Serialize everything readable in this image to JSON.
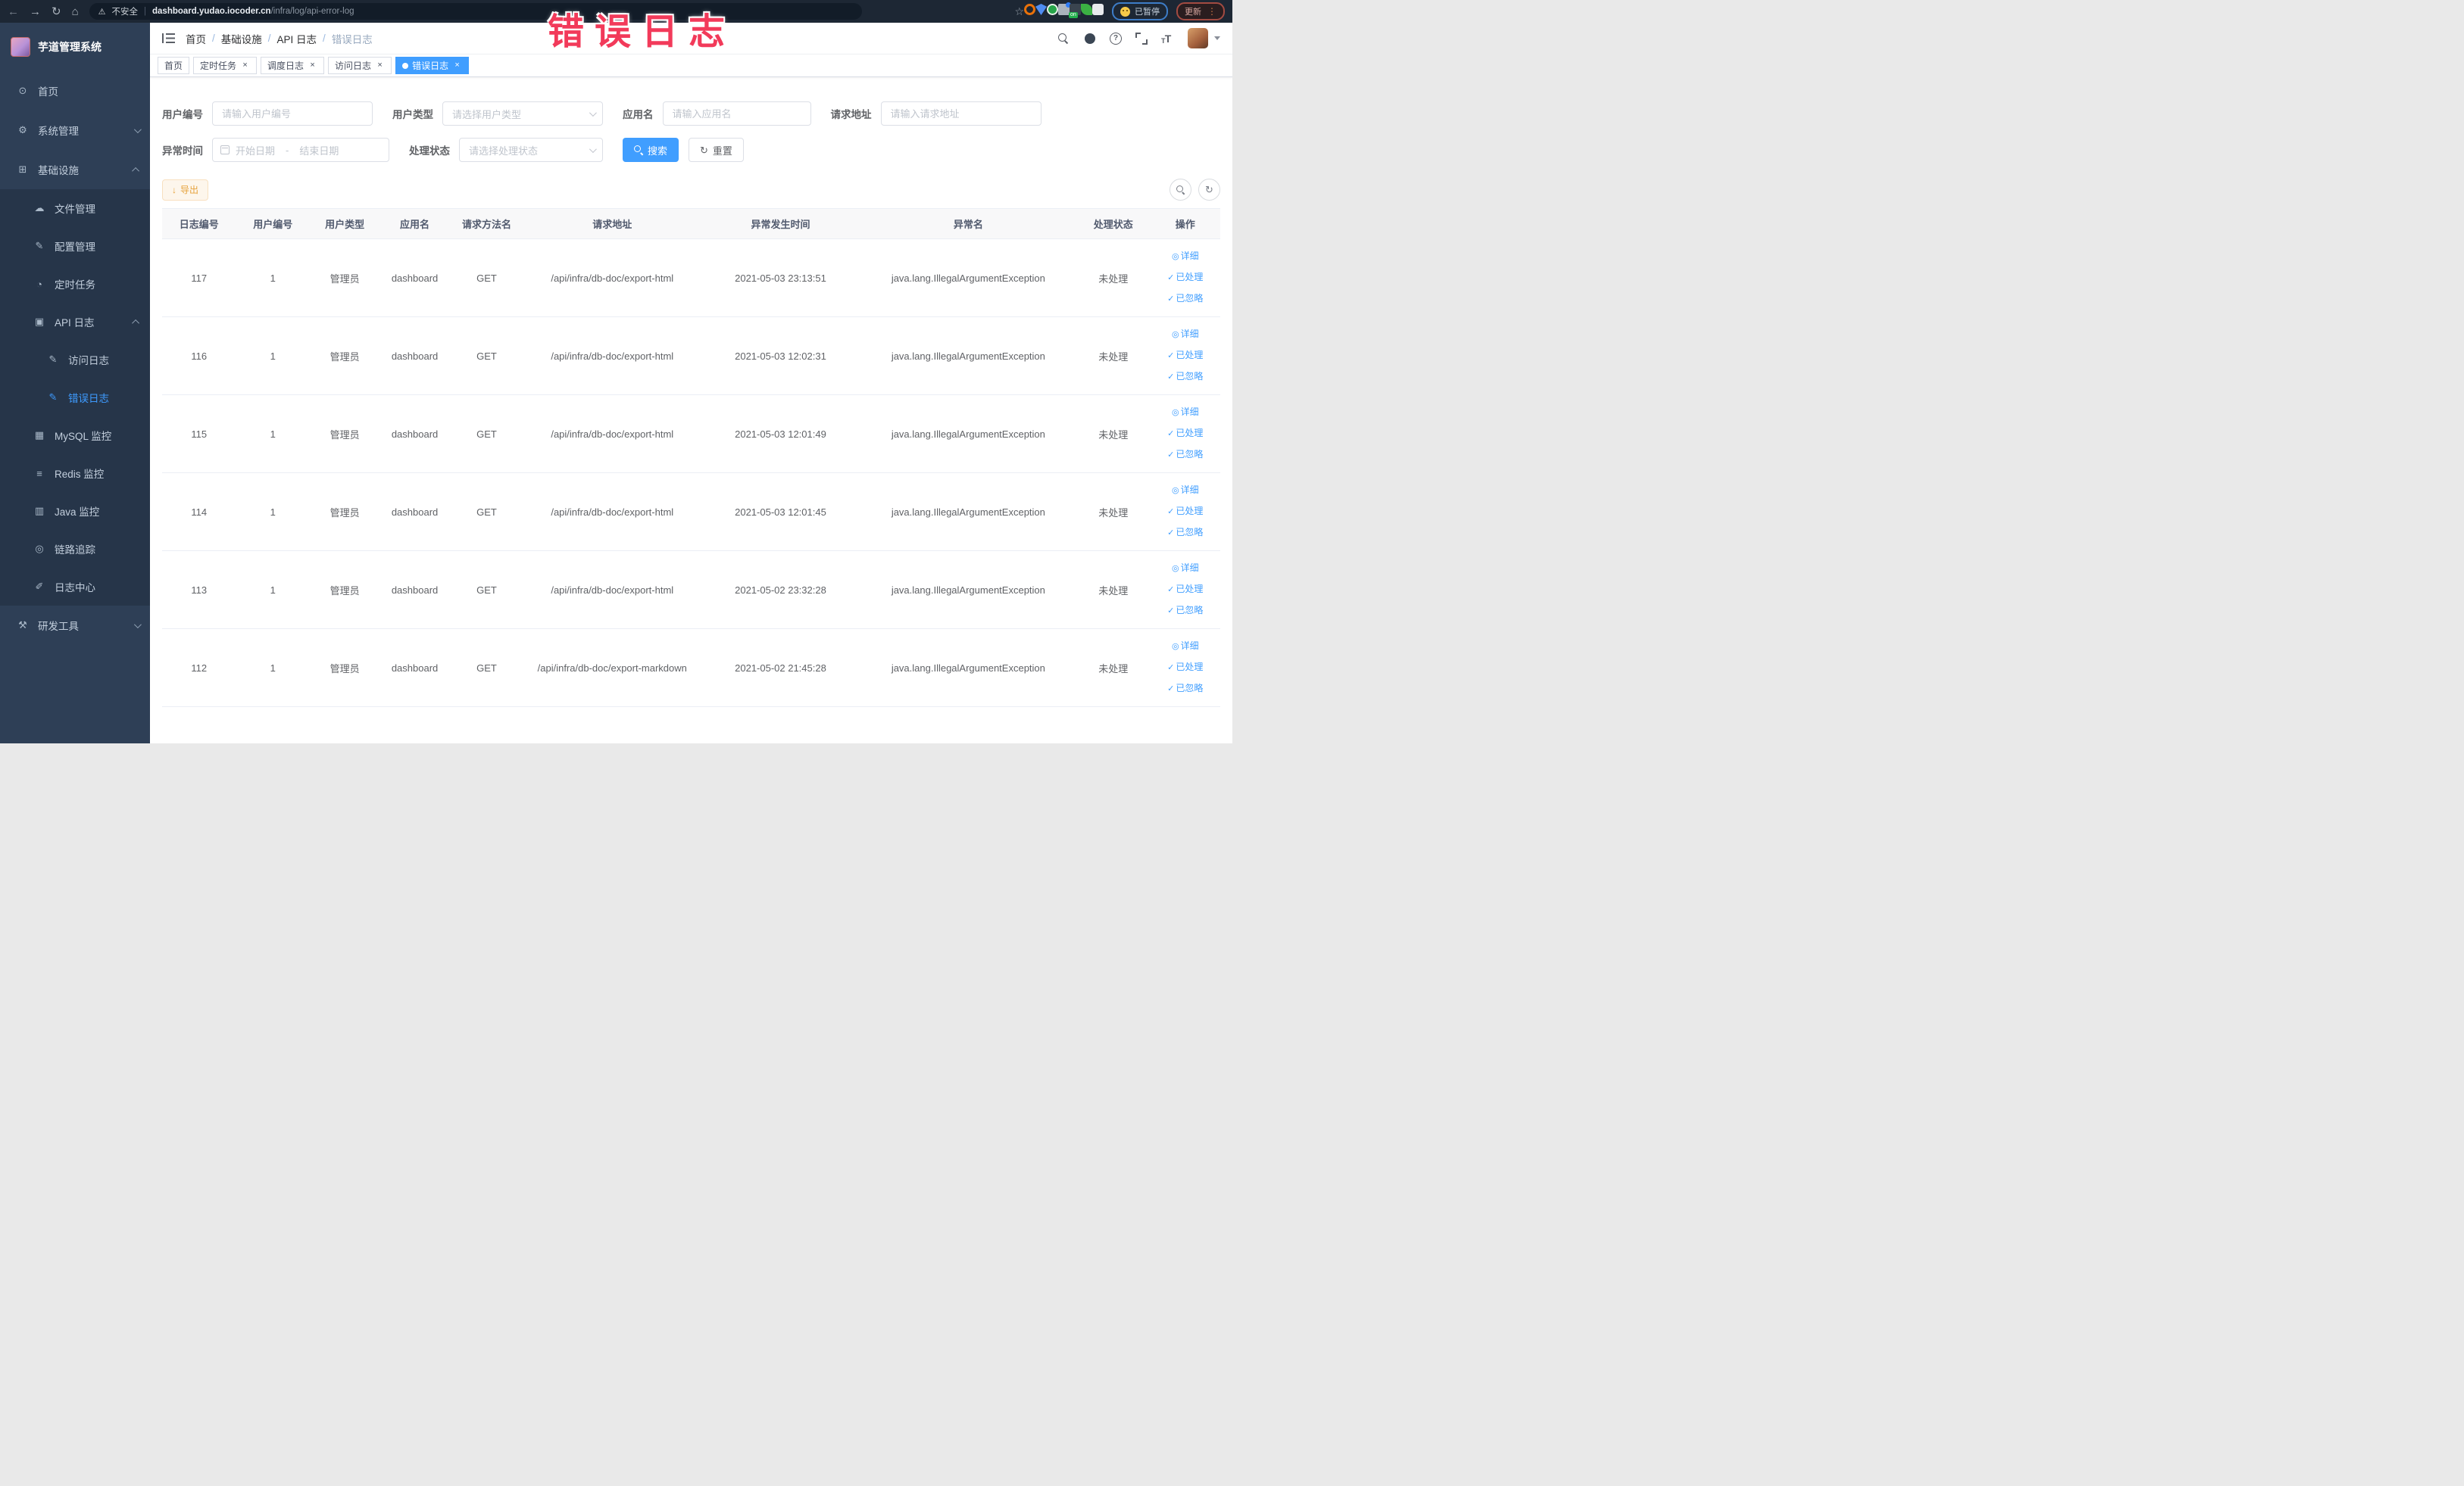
{
  "browser": {
    "security_label": "不安全",
    "url_host": "dashboard.yudao.iocoder.cn",
    "url_path": "/infra/log/api-error-log",
    "paused_label": "已暂停",
    "update_label": "更新",
    "kebab": "⋮",
    "nav": {
      "back": "←",
      "forward": "→",
      "reload": "↻",
      "home": "⌂",
      "warning": "⚠"
    },
    "ext_icons": [
      {
        "name": "bookmark-star-icon",
        "cls": "bi-star",
        "glyph": "☆"
      },
      {
        "name": "extension-orange-ring-icon",
        "cls": "bi-ring"
      },
      {
        "name": "extension-shield-icon",
        "cls": "bi-shield"
      },
      {
        "name": "extension-green-badge-icon",
        "cls": "bi-green"
      },
      {
        "name": "extension-grid-icon",
        "cls": "bi-grid"
      },
      {
        "name": "extension-onoff-icon",
        "cls": "bi-onoff"
      },
      {
        "name": "extension-leaf-icon",
        "cls": "bi-leaf"
      },
      {
        "name": "extensions-puzzle-icon",
        "cls": "bi-puzzle"
      }
    ]
  },
  "annotation": {
    "text": "错误日志",
    "color": "#f23a5a"
  },
  "sidebar": {
    "title": "芋道管理系统",
    "items": [
      {
        "name": "sidebar-item-home",
        "icon": "dashboard-icon",
        "glyph": "⊙",
        "label": "首页",
        "cls": "lvl1"
      },
      {
        "name": "sidebar-item-system",
        "icon": "gear-icon",
        "glyph": "⚙",
        "label": "系统管理",
        "cls": "lvl1",
        "chevdown": true
      },
      {
        "name": "sidebar-item-infra",
        "icon": "monitor-icon",
        "glyph": "⊞",
        "label": "基础设施",
        "cls": "lvl1",
        "chevup": true
      },
      {
        "name": "sidebar-item-file",
        "icon": "cloud-icon",
        "glyph": "☁",
        "label": "文件管理",
        "cls": "lvl2 insub"
      },
      {
        "name": "sidebar-item-config",
        "icon": "edit-icon",
        "glyph": "✎",
        "label": "配置管理",
        "cls": "lvl2 insub"
      },
      {
        "name": "sidebar-item-job",
        "icon": "clock-icon",
        "glyph": "◔",
        "label": "定时任务",
        "cls": "lvl2 insub"
      },
      {
        "name": "sidebar-item-api-log",
        "icon": "log-icon",
        "glyph": "▣",
        "label": "API 日志",
        "cls": "lvl2 insub",
        "chevup": true
      },
      {
        "name": "sidebar-item-access-log",
        "icon": "edit-icon",
        "glyph": "✎",
        "label": "访问日志",
        "cls": "lvl3 insub"
      },
      {
        "name": "sidebar-item-error-log",
        "icon": "edit-icon",
        "glyph": "✎",
        "label": "错误日志",
        "cls": "lvl3 insub active"
      },
      {
        "name": "sidebar-item-mysql",
        "icon": "database-icon",
        "glyph": "▦",
        "label": "MySQL 监控",
        "cls": "lvl2 insub"
      },
      {
        "name": "sidebar-item-redis",
        "icon": "layers-icon",
        "glyph": "≡",
        "label": "Redis 监控",
        "cls": "lvl2 insub"
      },
      {
        "name": "sidebar-item-java",
        "icon": "java-icon",
        "glyph": "▥",
        "label": "Java 监控",
        "cls": "lvl2 insub"
      },
      {
        "name": "sidebar-item-trace",
        "icon": "eye-icon",
        "glyph": "◎",
        "label": "链路追踪",
        "cls": "lvl2 insub"
      },
      {
        "name": "sidebar-item-log-center",
        "icon": "pencil-icon",
        "glyph": "✐",
        "label": "日志中心",
        "cls": "lvl2 insub"
      },
      {
        "name": "sidebar-item-devtools",
        "icon": "toolbox-icon",
        "glyph": "⚒",
        "label": "研发工具",
        "cls": "lvl1",
        "chevdown": true
      }
    ]
  },
  "header": {
    "breadcrumb": {
      "home": "首页",
      "infra": "基础设施",
      "api_log": "API 日志",
      "current": "错误日志",
      "sep": "/"
    },
    "icons": [
      {
        "name": "search-icon",
        "cls": "hi-search"
      },
      {
        "name": "github-icon",
        "cls": "hi-github"
      },
      {
        "name": "help-icon",
        "cls": "hi-help",
        "glyph": "?"
      },
      {
        "name": "fullscreen-icon",
        "cls": "hi-fullscreen"
      },
      {
        "name": "font-size-icon",
        "cls": "hi-fontsize",
        "glyph": "T"
      }
    ]
  },
  "tabs": [
    {
      "label": "首页"
    },
    {
      "label": "定时任务",
      "closable": true
    },
    {
      "label": "调度日志",
      "closable": true
    },
    {
      "label": "访问日志",
      "closable": true
    },
    {
      "label": "错误日志",
      "closable": true,
      "active": true
    }
  ],
  "tab_close_glyph": "×",
  "filters": {
    "user_id": {
      "label": "用户编号",
      "placeholder": "请输入用户编号"
    },
    "user_type": {
      "label": "用户类型",
      "placeholder": "请选择用户类型"
    },
    "app_name": {
      "label": "应用名",
      "placeholder": "请输入应用名"
    },
    "req_url": {
      "label": "请求地址",
      "placeholder": "请输入请求地址"
    },
    "exc_time": {
      "label": "异常时间",
      "start_placeholder": "开始日期",
      "separator": "-",
      "end_placeholder": "结束日期"
    },
    "status": {
      "label": "处理状态",
      "placeholder": "请选择处理状态"
    }
  },
  "actions": {
    "search": "搜索",
    "reset": "重置",
    "reset_icon": "↻",
    "export": "导出",
    "export_icon": "↓",
    "refresh_icon": "↻"
  },
  "table": {
    "columns": [
      "日志编号",
      "用户编号",
      "用户类型",
      "应用名",
      "请求方法名",
      "请求地址",
      "异常发生时间",
      "异常名",
      "处理状态",
      "操作"
    ],
    "rows": [
      {
        "id": "117",
        "user_id": "1",
        "user_type": "管理员",
        "app": "dashboard",
        "method": "GET",
        "url": "/api/infra/db-doc/export-html",
        "time": "2021-05-03 23:13:51",
        "exception": "java.lang.IllegalArgumentException",
        "status": "未处理"
      },
      {
        "id": "116",
        "user_id": "1",
        "user_type": "管理员",
        "app": "dashboard",
        "method": "GET",
        "url": "/api/infra/db-doc/export-html",
        "time": "2021-05-03 12:02:31",
        "exception": "java.lang.IllegalArgumentException",
        "status": "未处理"
      },
      {
        "id": "115",
        "user_id": "1",
        "user_type": "管理员",
        "app": "dashboard",
        "method": "GET",
        "url": "/api/infra/db-doc/export-html",
        "time": "2021-05-03 12:01:49",
        "exception": "java.lang.IllegalArgumentException",
        "status": "未处理"
      },
      {
        "id": "114",
        "user_id": "1",
        "user_type": "管理员",
        "app": "dashboard",
        "method": "GET",
        "url": "/api/infra/db-doc/export-html",
        "time": "2021-05-03 12:01:45",
        "exception": "java.lang.IllegalArgumentException",
        "status": "未处理"
      },
      {
        "id": "113",
        "user_id": "1",
        "user_type": "管理员",
        "app": "dashboard",
        "method": "GET",
        "url": "/api/infra/db-doc/export-html",
        "time": "2021-05-02 23:32:28",
        "exception": "java.lang.IllegalArgumentException",
        "status": "未处理"
      },
      {
        "id": "112",
        "user_id": "1",
        "user_type": "管理员",
        "app": "dashboard",
        "method": "GET",
        "url": "/api/infra/db-doc/export-markdown",
        "time": "2021-05-02 21:45:28",
        "exception": "java.lang.IllegalArgumentException",
        "status": "未处理"
      }
    ]
  },
  "ops": {
    "detail": "详细",
    "detail_icon": "◎",
    "processed": "已处理",
    "ignored": "已忽略",
    "check_icon": "✓"
  }
}
